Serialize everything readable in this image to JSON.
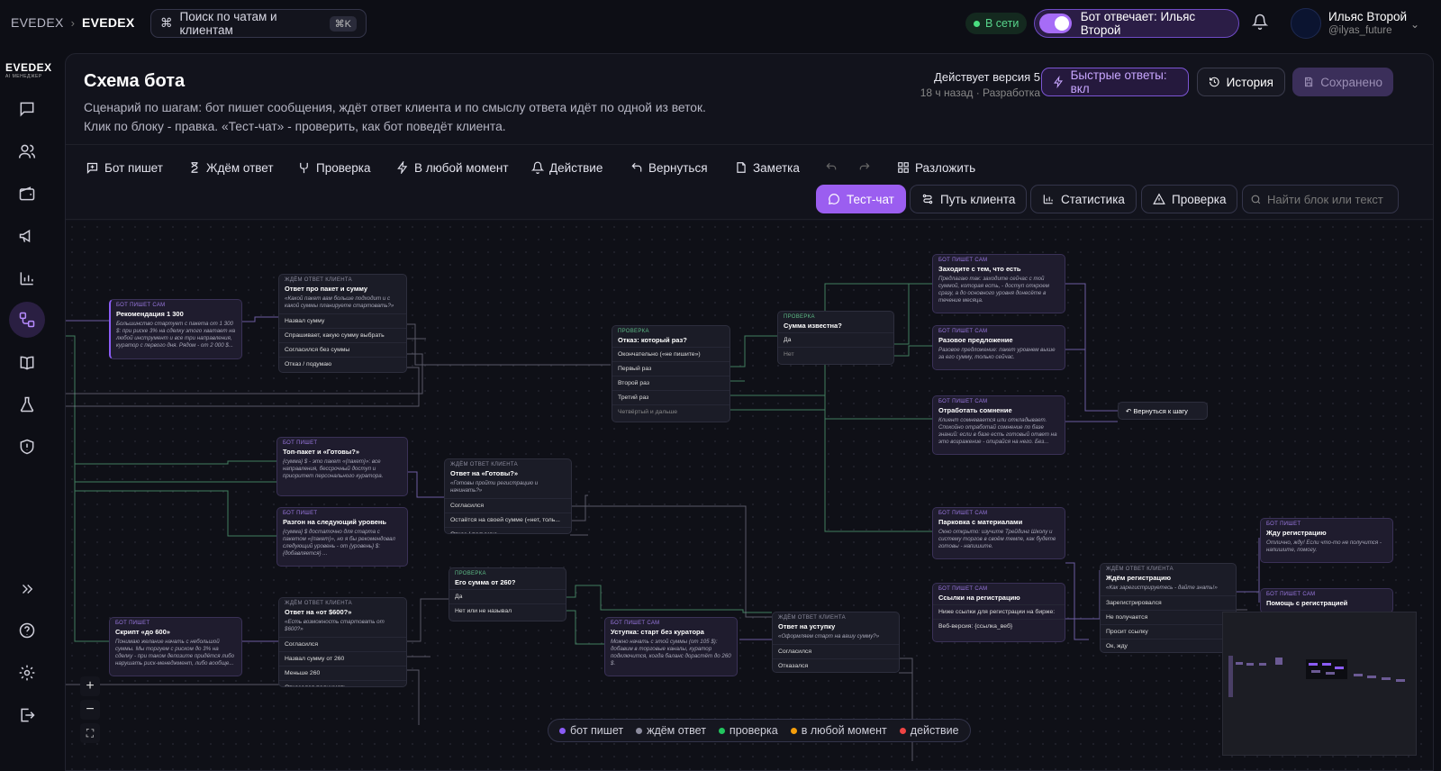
{
  "header": {
    "crumb_root": "EVEDEX",
    "crumb_current": "EVEDEX",
    "search_placeholder": "Поиск по чатам и клиентам",
    "search_shortcut": "⌘K",
    "status": "В сети",
    "bot_toggle_label": "Бот отвечает: Ильяс Второй",
    "user_name": "Ильяс Второй",
    "user_handle": "@ilyas_future"
  },
  "sidebar": {
    "logo": "EVEDEX",
    "logo_sub": "AI МЕНЕДЖЕР"
  },
  "page": {
    "title": "Схема бота",
    "description": "Сценарий по шагам: бот пишет сообщения, ждёт ответ клиента и по смыслу ответа идёт по одной из веток. Клик по блоку - правка. «Тест-чат» - проверить, как бот поведёт клиента.",
    "version": "Действует версия 5",
    "version_meta": "18 ч назад · Разработка",
    "quick_replies": "Быстрые ответы: вкл",
    "history": "История",
    "saved": "Сохранено"
  },
  "toolbar": {
    "tools": [
      "Бот пишет",
      "Ждём ответ",
      "Проверка",
      "В любой момент",
      "Действие",
      "Вернуться",
      "Заметка"
    ],
    "arrange": "Разложить",
    "test_chat": "Тест-чат",
    "client_path": "Путь клиента",
    "stats": "Статистика",
    "check": "Проверка",
    "find_placeholder": "Найти блок или текст"
  },
  "types": {
    "bot": "Бот пишет сам",
    "bot2": "Бот пишет",
    "wait": "Ждём ответ клиента",
    "check": "Проверка"
  },
  "nodes": {
    "n1": {
      "title": "Рекомендация 1 300",
      "desc": "Большинство стартует с пакета от 1 300 $: при риске 3% на сделку этого хватает на любой инструмент и все три направления, куратор с первого дня. Рядом - от 2 000 $..."
    },
    "n2": {
      "title": "Ответ про пакет и сумму",
      "desc": "«Какой пакет вам больше подходит и с какой суммы планируете стартовать?»",
      "opts": [
        "Назвал сумму",
        "Спрашивает, какую сумму выбрать",
        "Согласился без суммы",
        "Отказ / подумаю"
      ]
    },
    "n3": {
      "title": "Топ-пакет и «Готовы?»",
      "desc": "{сумма} $ - это пакет «{пакет}»: все направления, бессрочный доступ и приоритет персонального куратора."
    },
    "n4": {
      "title": "Разгон на следующий уровень",
      "desc": "{сумма} $ достаточно для старта с пакетом «{пакет}», но я бы рекомендовал следующий уровень - от {уровень} $: {добавляется} ..."
    },
    "n5": {
      "title": "Ответ на «Готовы?»",
      "desc": "«Готовы пройти регистрацию и начинать?»",
      "opts": [
        "Согласился",
        "Остаётся на своей сумме («нет, толь...",
        "Отказ / подумаю"
      ]
    },
    "n6": {
      "title": "Скрипт «до 600»",
      "desc": "Понимаю желание начать с небольшой суммы. Мы торгуем с риском до 3% на сделку - при таком депозите придётся либо нарушать риск-менеджмент, либо вообще..."
    },
    "n7": {
      "title": "Ответ на «от $600?»",
      "desc": "«Есть возможность стартовать от $600?»",
      "opts": [
        "Согласился",
        "Назвал сумму от 260",
        "Меньше 260",
        "Отказался поднимать"
      ]
    },
    "n8": {
      "title": "Его сумма от 260?",
      "opts": [
        "Да",
        "Нет или не называл"
      ]
    },
    "n9": {
      "title": "Отказ: который раз?",
      "opts": [
        "Окончательно («не пишите»)",
        "Первый раз",
        "Второй раз",
        "Третий раз",
        "Четвёртый и дальше"
      ]
    },
    "n10": {
      "title": "Сумма известна?",
      "opts": [
        "Да",
        "Нет"
      ]
    },
    "n11": {
      "title": "Уступка: старт без куратора",
      "desc": "Можно начать с этой суммы (от 105 $): добавим в торговые каналы, куратор подключится, когда баланс дорастёт до 260 $."
    },
    "n12": {
      "title": "Ответ на уступку",
      "desc": "«Оформляем старт на вашу сумму?»",
      "opts": [
        "Согласился",
        "Отказался"
      ]
    },
    "n13": {
      "title": "Заходите с тем, что есть",
      "desc": "Предлагаю так: заходите сейчас с той суммой, которая есть, - доступ откроем сразу, а до основного уровня донесёте в течение месяца."
    },
    "n14": {
      "title": "Разовое предложение",
      "desc": "Разовое предложение: пакет уровнем выше за его сумму, только сейчас."
    },
    "n15": {
      "title": "Отработать сомнение",
      "desc": "Клиент сомневается или откладывает. Спокойно отработай сомнение по базе знаний: если в базе есть готовый ответ на это возражение - опирайся на него. Без..."
    },
    "n16": {
      "title": "Парковка с материалами",
      "desc": "Окно открыто: изучите Трейдинг Школу и систему торгов в своём темпе, как будете готовы - напишите."
    },
    "n17": {
      "title": "Ссылки на регистрацию",
      "opts": [
        "Ниже ссылки для регистрации на бирже:",
        "Веб-версия: {ссылка_веб}"
      ]
    },
    "n18": {
      "title": "Ждём регистрацию",
      "desc": "«Как зарегистрируетесь - дайте знать!»",
      "opts": [
        "Зарегистрировался",
        "Не получается",
        "Просит ссылку",
        "Ок, жду"
      ]
    },
    "n19": {
      "title": "Жду регистрацию",
      "desc": "Отлично, жду! Если что-то не получится - напишите, помогу."
    },
    "n20": {
      "title": "Помощь с регистрацией"
    },
    "n21": {
      "title": "Вернуться к шагу"
    }
  },
  "legend": [
    "бот пишет",
    "ждём ответ",
    "проверка",
    "в любой момент",
    "действие"
  ],
  "colors": {
    "accent": "#9b5ef0",
    "bot": "#8b5cf6",
    "wait": "#8c8c9e",
    "check": "#22c55e",
    "anytime": "#f59e0b",
    "action": "#ef4444"
  }
}
